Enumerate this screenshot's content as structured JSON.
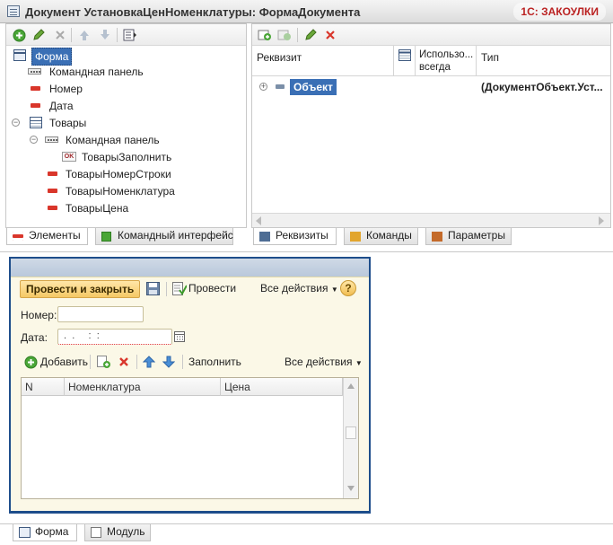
{
  "window": {
    "title": "Документ УстановкаЦенНоменклатуры: ФормаДокумента",
    "watermark": "1С: ЗАКОУЛКИ"
  },
  "elements_tree": {
    "items": [
      {
        "label": "Форма",
        "selected": true
      },
      {
        "label": "Командная панель"
      },
      {
        "label": "Номер"
      },
      {
        "label": "Дата"
      },
      {
        "label": "Товары"
      },
      {
        "label": "Командная панель"
      },
      {
        "label": "ТоварыЗаполнить"
      },
      {
        "label": "ТоварыНомерСтроки"
      },
      {
        "label": "ТоварыНоменклатура"
      },
      {
        "label": "ТоварыЦена"
      }
    ],
    "ok_icon_text": "OK"
  },
  "left_tabs": {
    "elements": "Элементы",
    "command_interface": "Командный интерфейс"
  },
  "attributes": {
    "columns": {
      "attribute": "Реквизит",
      "use_always": "Использо... всегда",
      "type": "Тип"
    },
    "rows": [
      {
        "name": "Объект",
        "type": "(ДокументОбъект.Уст..."
      }
    ]
  },
  "right_tabs": {
    "attributes": "Реквизиты",
    "commands": "Команды",
    "parameters": "Параметры"
  },
  "preview": {
    "post_and_close": "Провести и закрыть",
    "post": "Провести",
    "all_actions": "Все действия",
    "help": "?",
    "number_label": "Номер:",
    "number_value": "",
    "date_label": "Дата:",
    "date_value": " .  .     :  :",
    "table_toolbar": {
      "add": "Добавить",
      "fill": "Заполнить",
      "all_actions": "Все действия"
    },
    "table_columns": [
      "N",
      "Номенклатура",
      "Цена"
    ]
  },
  "bottom_tabs": {
    "form": "Форма",
    "module": "Модуль"
  },
  "colors": {
    "accent_blue": "#1d4d8a",
    "selection": "#3a6fb5",
    "delete_red": "#d9362b",
    "add_green": "#3c9b2a"
  }
}
